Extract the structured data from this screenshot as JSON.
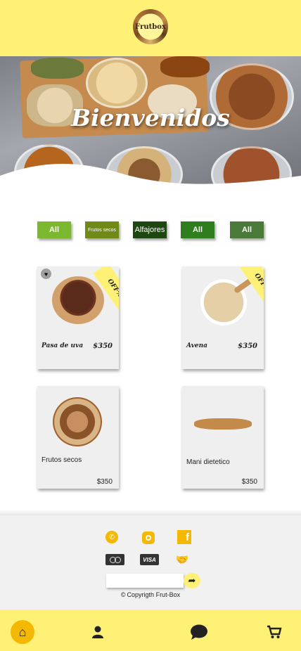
{
  "header": {
    "logo_text": "Frutbox"
  },
  "hero": {
    "title": "Bienvenidos"
  },
  "filters": [
    {
      "label": "All"
    },
    {
      "label": "Frutos secos"
    },
    {
      "label": "Alfajores"
    },
    {
      "label": "All"
    },
    {
      "label": "All"
    }
  ],
  "products": [
    {
      "name": "Pasa de uva",
      "price": "$350",
      "badge": "OFF%",
      "favorite_icon": "heart-icon"
    },
    {
      "name": "Avena",
      "price": "$350",
      "badge": "OFF%"
    },
    {
      "name": "Frutos secos",
      "price": "$350"
    },
    {
      "name": "Mani dietetico",
      "price": "$350"
    }
  ],
  "footer": {
    "social_icons": [
      "whatsapp-icon",
      "instagram-icon",
      "facebook-icon"
    ],
    "payment_icons": [
      "mastercard-icon",
      "visa-icon",
      "handshake-icon"
    ],
    "visa_label": "VISA",
    "facebook_glyph": "f",
    "newsletter_placeholder": "",
    "copyright": "Copyrigth Frut-Box"
  },
  "bottom_nav": [
    "home-icon",
    "user-icon",
    "chat-icon",
    "cart-icon"
  ],
  "colors": {
    "accent_yellow": "#fff176",
    "icon_gold": "#f5b800",
    "card_bg": "#efefef"
  }
}
